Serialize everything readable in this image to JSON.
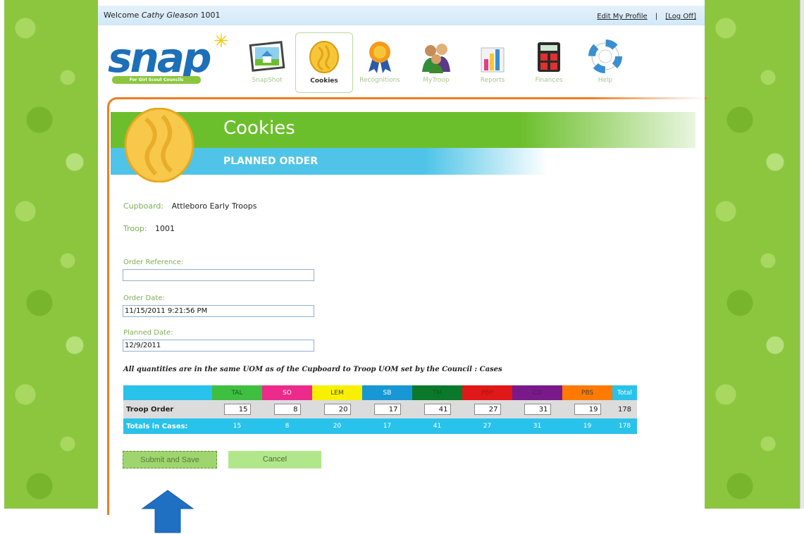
{
  "header": {
    "welcome_prefix": "Welcome",
    "user_name": "Cathy Gleason",
    "troop_id": "1001",
    "edit_profile": "Edit My Profile",
    "separator": "|",
    "log_off": "[Log Off]"
  },
  "logo": {
    "text": "snap",
    "subtitle": "For Girl Scout Councils",
    "star": "✳"
  },
  "nav": {
    "items": [
      {
        "label": "SnapShot",
        "icon": "house-picture-icon",
        "active": false
      },
      {
        "label": "Cookies",
        "icon": "cookie-icon",
        "active": true
      },
      {
        "label": "Recognitions",
        "icon": "award-ribbon-icon",
        "active": false
      },
      {
        "label": "MyTroop",
        "icon": "troop-people-icon",
        "active": false
      },
      {
        "label": "Reports",
        "icon": "bar-chart-icon",
        "active": false
      },
      {
        "label": "Finances",
        "icon": "calculator-icon",
        "active": false
      },
      {
        "label": "Help",
        "icon": "life-preserver-icon",
        "active": false
      }
    ]
  },
  "banner": {
    "title": "Cookies",
    "subtitle": "PLANNED ORDER"
  },
  "form": {
    "cupboard_label": "Cupboard:",
    "cupboard_value": "Attleboro Early Troops",
    "troop_label": "Troop:",
    "troop_value": "1001",
    "order_reference_label": "Order Reference:",
    "order_reference_value": "",
    "order_date_label": "Order Date:",
    "order_date_value": "11/15/2011 9:21:56 PM",
    "planned_date_label": "Planned Date:",
    "planned_date_value": "12/9/2011",
    "uom_note": "All quantities are in the same UOM as of the Cupboard to Troop UOM set by the Council : Cases"
  },
  "order_table": {
    "columns": [
      {
        "code": "TAL",
        "color": "#3fbf3f",
        "text_color": "#1a5a1a"
      },
      {
        "code": "SO",
        "color": "#ec2a8c",
        "text_color": "#ffffff"
      },
      {
        "code": "LEM",
        "color": "#f8f000",
        "text_color": "#444444"
      },
      {
        "code": "SB",
        "color": "#1798d4",
        "text_color": "#ffffff"
      },
      {
        "code": "TM",
        "color": "#0a7a2a",
        "text_color": "#0a5a20"
      },
      {
        "code": "PBP",
        "color": "#e01818",
        "text_color": "#b01010"
      },
      {
        "code": "CD",
        "color": "#7a1a8a",
        "text_color": "#5a0f6a"
      },
      {
        "code": "PBS",
        "color": "#ff7a00",
        "text_color": "#444444"
      }
    ],
    "total_header": "Total",
    "total_header_color": "#29c2ea",
    "troop_order_label": "Troop Order",
    "troop_order_values": [
      "15",
      "8",
      "20",
      "17",
      "41",
      "27",
      "31",
      "19"
    ],
    "troop_order_total": "178",
    "totals_label": "Totals in Cases:",
    "totals_values": [
      "15",
      "8",
      "20",
      "17",
      "41",
      "27",
      "31",
      "19"
    ],
    "totals_total": "178"
  },
  "buttons": {
    "submit": "Submit and Save",
    "cancel": "Cancel"
  },
  "colors": {
    "accent_green": "#6cbf2c",
    "accent_blue": "#4fc4e8",
    "frame_orange": "#ee7d22",
    "arrow_blue": "#1f6fc3"
  }
}
